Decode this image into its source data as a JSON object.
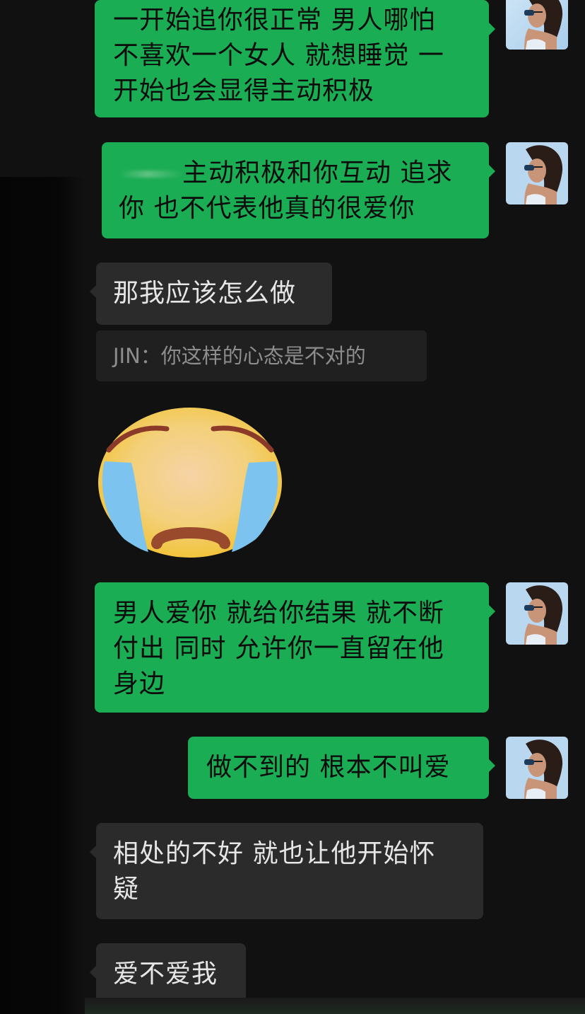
{
  "messages": [
    {
      "id": "m1",
      "direction": "outgoing",
      "text": "一开始追你很正常 男人哪怕不喜欢一个女人 就想睡觉 一开始也会显得主动积极"
    },
    {
      "id": "m2",
      "direction": "outgoing",
      "text": "主动积极和你互动 追求你 也不代表他真的很爱你"
    },
    {
      "id": "m3",
      "direction": "incoming",
      "text": "那我应该怎么做"
    },
    {
      "id": "q1",
      "type": "quote",
      "author": "JIN",
      "text": "你这样的心态是不对的"
    },
    {
      "id": "s1",
      "type": "sticker",
      "sticker_name": "crying-face-icon"
    },
    {
      "id": "m4",
      "direction": "outgoing",
      "text": "男人爱你 就给你结果 就不断付出 同时 允许你一直留在他身边"
    },
    {
      "id": "m5",
      "direction": "outgoing",
      "text": "做不到的 根本不叫爱"
    },
    {
      "id": "m6",
      "direction": "incoming",
      "text": "相处的不好 就也让他开始怀疑"
    },
    {
      "id": "m7",
      "direction": "incoming",
      "text": "爱不爱我"
    }
  ],
  "lines": {
    "m1": [
      "一开始追你很正常 男人哪怕",
      "不喜欢一个女人 就想睡觉 一",
      "开始也会显得主动积极"
    ],
    "m2": [
      "主动积极和你互动 追求",
      "你 也不代表他真的很爱你"
    ],
    "m4": [
      "男人爱你 就给你结果 就不断",
      "付出 同时 允许你一直留在他",
      "身边"
    ],
    "m6": [
      "相处的不好 就也让他开始怀",
      "疑"
    ]
  },
  "quote_label": "JIN：你这样的心态是不对的",
  "colors": {
    "background": "#111111",
    "outgoing_bubble": "#1aad53",
    "incoming_bubble": "#2b2b2b",
    "quote_bg": "#202020",
    "quote_text": "#8d8d8d"
  }
}
